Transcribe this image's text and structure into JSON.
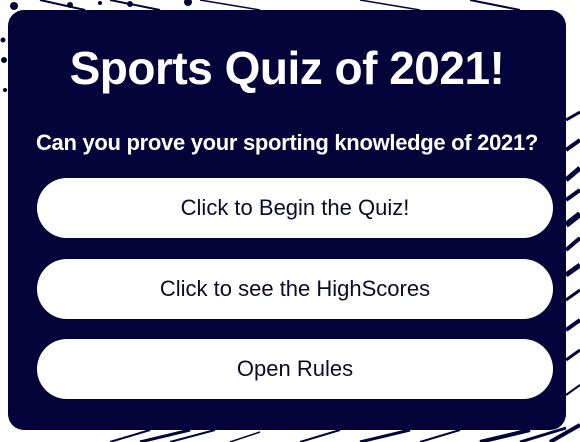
{
  "quiz": {
    "title": "Sports Quiz of 2021!",
    "subtitle": "Can you prove your sporting knowledge of 2021?",
    "buttons": {
      "begin_label": "Click to Begin the Quiz!",
      "highscores_label": "Click to see the HighScores",
      "rules_label": "Open Rules"
    }
  },
  "colors": {
    "card_background": "#03033a",
    "button_background": "#ffffff",
    "button_text": "#0b0b2a",
    "text": "#ffffff"
  }
}
